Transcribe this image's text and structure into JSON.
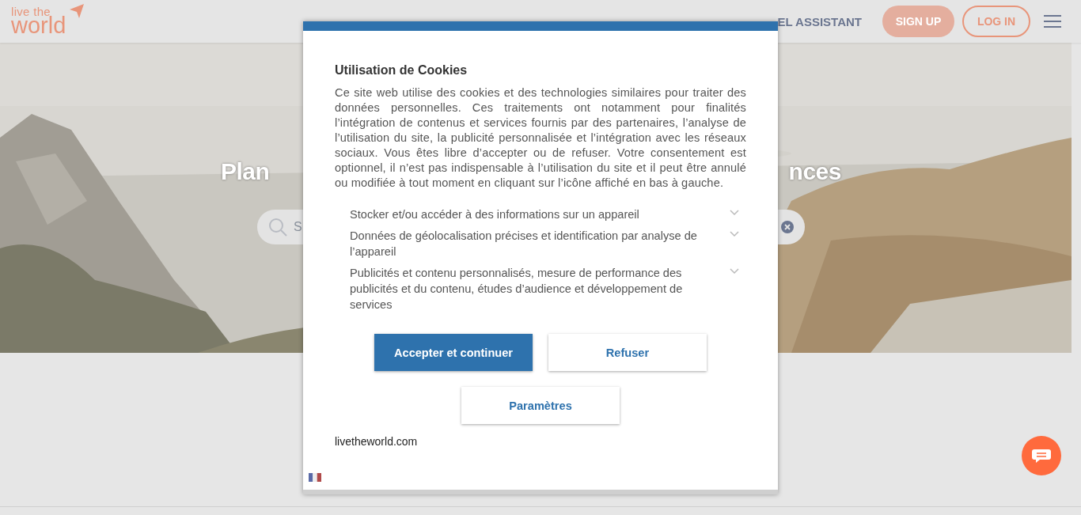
{
  "header": {
    "logo": [
      "live the",
      "world"
    ],
    "nav": [
      "EL ASSISTANT"
    ],
    "sign_up": "SIGN UP",
    "log_in": "LOG IN"
  },
  "hero": {
    "title_parts": [
      "Plan",
      "nces"
    ],
    "search": {
      "placeholder": "S"
    }
  },
  "cookie_dialog": {
    "title": "Utilisation de Cookies",
    "text": "Ce site web utilise des cookies et des technologies similaires pour traiter des données personnelles. Ces traitements ont notamment pour finalités l’intégration de contenus et services fournis par des partenaires, l’analyse de l’utilisation du site, la publicité personnalisée et l’intégration avec les réseaux sociaux. Vous êtes libre d’accepter ou de refuser. Votre consentement est optionnel, il n’est pas indispensable à l’utilisation du site et il peut être annulé ou modifiée à tout moment en cliquant sur l’icône affiché en bas à gauche.",
    "purposes": [
      {
        "label": "Stocker et/ou accéder à des informations sur un appareil",
        "expanded": false
      },
      {
        "label": "Données de géolocalisation précises et identification par analyse de l’appareil",
        "expanded": false
      },
      {
        "label": "Publicités et contenu personnalisés, mesure de performance des publicités et du contenu, études d’audience et développement de services",
        "expanded": false
      }
    ],
    "buttons": [
      {
        "label": "Accepter et continuer",
        "kind": "primary"
      },
      {
        "label": "Refuser",
        "kind": "secondary"
      },
      {
        "label": "Paramètres",
        "kind": "secondary"
      }
    ],
    "site": "livetheworld.com"
  }
}
